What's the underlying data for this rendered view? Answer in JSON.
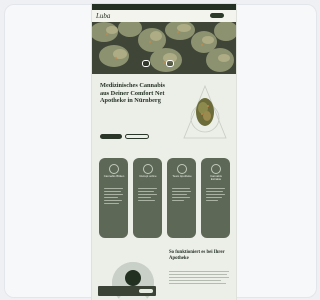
{
  "site": {
    "topbar": {
      "left": "",
      "right": ""
    },
    "nav": {
      "logo": "Luba",
      "links": [
        "",
        "",
        ""
      ],
      "cta": ""
    },
    "hero": {
      "buttons": [
        "",
        ""
      ]
    },
    "headline": "Medizinisches Cannabis aus Deiner Comfort Net Apotheke in Nürnberg",
    "buttons": {
      "primary": "",
      "secondary": ""
    },
    "cards": [
      {
        "title": "Cannabis Blüten"
      },
      {
        "title": "Rezept online"
      },
      {
        "title": "Team Apotheke"
      },
      {
        "title": "Cannabis Extrakte"
      }
    ],
    "section2": {
      "title": "So funktioniert es bei Ihrer Apotheke",
      "subtitle": ""
    },
    "cookie": {
      "text": "",
      "button": ""
    }
  }
}
